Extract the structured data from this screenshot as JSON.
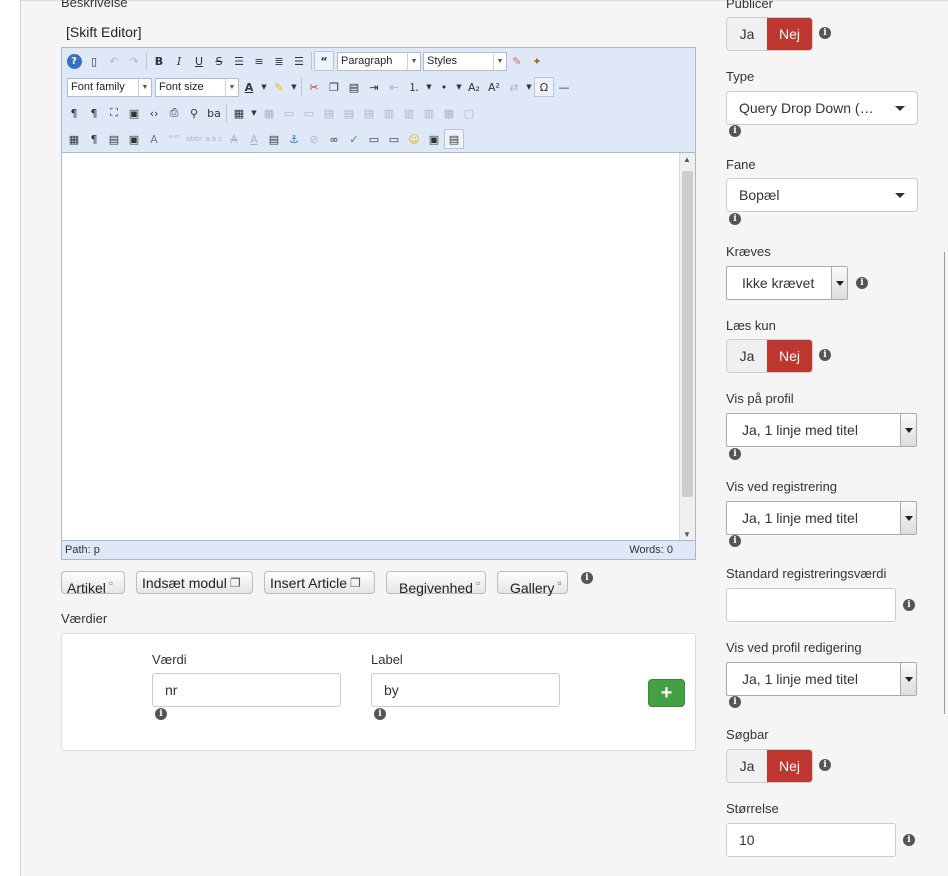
{
  "left": {
    "description_label": "Beskrivelse",
    "editor_title": "[Skift Editor]",
    "toolbar": {
      "paragraph": "Paragraph",
      "styles": "Styles",
      "font_family": "Font family",
      "font_size": "Font size"
    },
    "status": {
      "path": "Path: p",
      "words": "Words: 0"
    },
    "buttons": [
      "Artikel",
      "Indsæt modul",
      "Insert Article",
      "Begivenhed",
      "Gallery"
    ],
    "values_label": "Værdier",
    "value_col_label": "Værdi",
    "value_input": "nr",
    "label_col_label": "Label",
    "label_input": "by"
  },
  "right": {
    "publicer_label": "Publicer",
    "ja": "Ja",
    "nej": "Nej",
    "type_label": "Type",
    "type_value": "Query Drop Down (…",
    "fane_label": "Fane",
    "fane_value": "Bopæl",
    "kraeves_label": "Kræves",
    "kraeves_value": "Ikke krævet",
    "laes_kun_label": "Læs kun",
    "vis_profil_label": "Vis på profil",
    "vis_profil_value": "Ja, 1 linje med titel",
    "vis_reg_label": "Vis ved registrering",
    "vis_reg_value": "Ja, 1 linje med titel",
    "std_reg_label": "Standard registreringsværdi",
    "std_reg_value": "",
    "vis_redig_label": "Vis ved profil redigering",
    "vis_redig_value": "Ja, 1 linje med titel",
    "soegbar_label": "Søgbar",
    "stoerrelse_label": "Størrelse",
    "stoerrelse_value": "10"
  },
  "colors": {
    "danger": "#bd362f",
    "success": "#45a044",
    "editor_bg": "#dfe8f6"
  }
}
